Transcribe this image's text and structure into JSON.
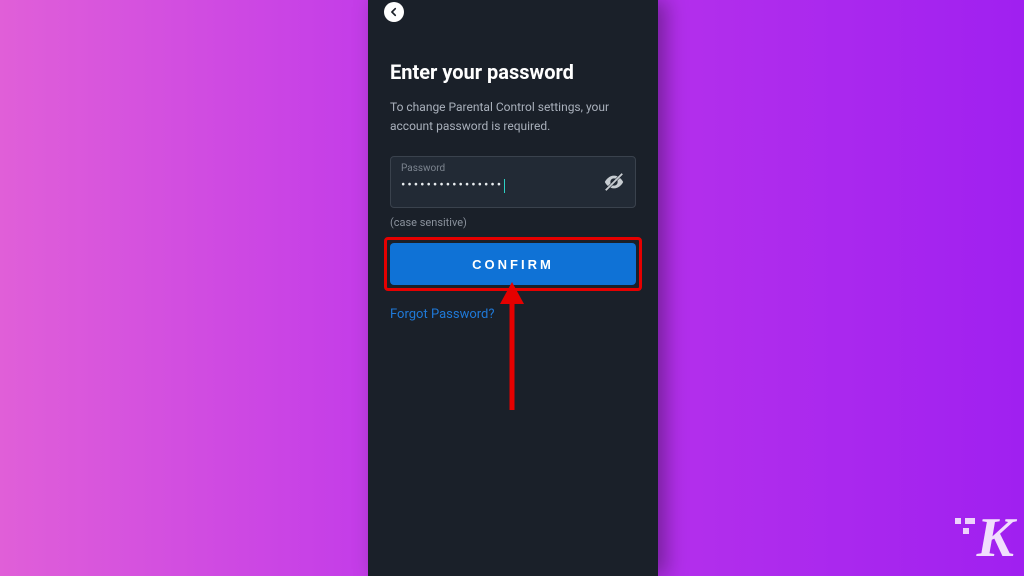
{
  "screen": {
    "title": "Enter your password",
    "subtitle": "To change Parental Control settings, your account password is required.",
    "password": {
      "label": "Password",
      "masked": "••••••••••••••••",
      "hint": "(case sensitive)"
    },
    "confirm_label": "CONFIRM",
    "forgot_label": "Forgot Password?"
  },
  "watermark": "K"
}
